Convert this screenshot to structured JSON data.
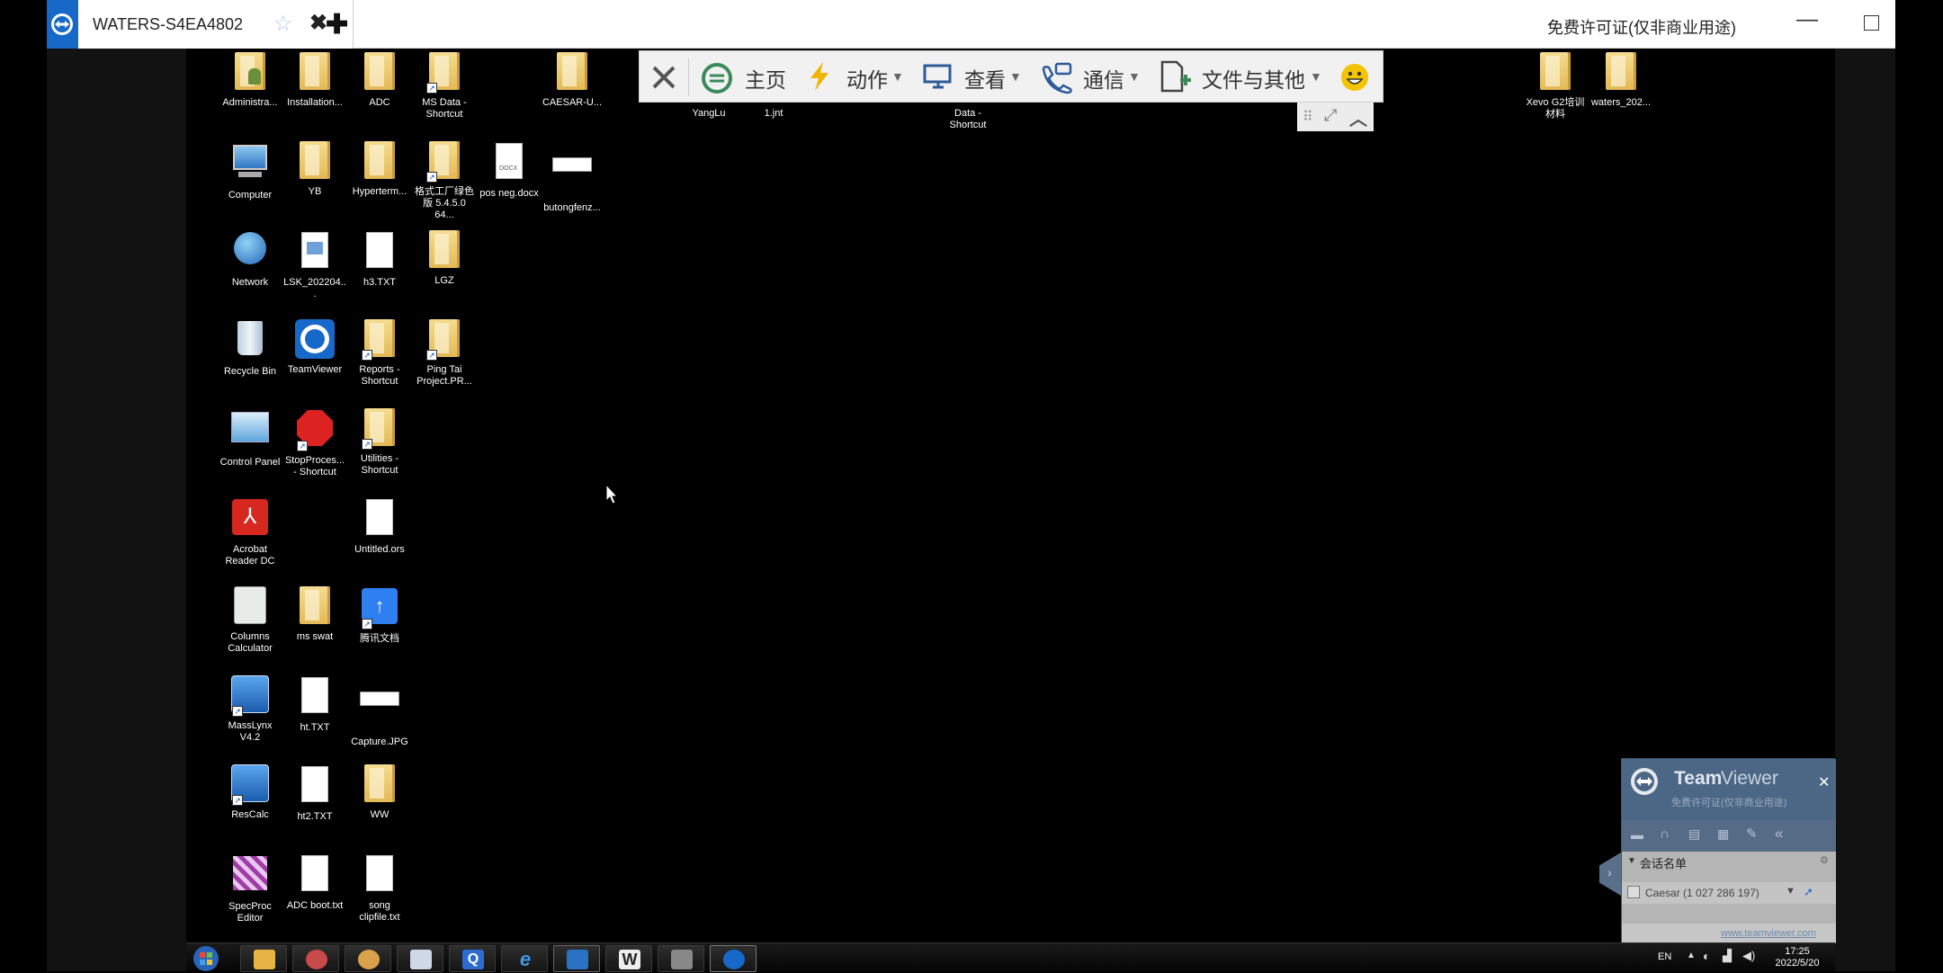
{
  "window": {
    "tab_title": "WATERS-S4EA4802",
    "license_text": "免费许可证(仅非商业用途)",
    "add_tab_glyph": "✚",
    "close_glyph": "✖",
    "star_glyph": "☆"
  },
  "toolbar": {
    "home_label": "主页",
    "actions_label": "动作",
    "view_label": "查看",
    "communicate_label": "通信",
    "files_label": "文件与其他"
  },
  "desktop": {
    "icons": [
      {
        "label": "Administra...",
        "kind": "user-folder-icon"
      },
      {
        "label": "Installation...",
        "kind": "folder-icon"
      },
      {
        "label": "ADC",
        "kind": "folder-icon"
      },
      {
        "label": "MS Data - Shortcut",
        "kind": "folder-shortcut-icon"
      },
      {
        "label": "CAESAR-U...",
        "kind": "folder-icon"
      },
      {
        "label": "YangLu",
        "kind": "folder-icon"
      },
      {
        "label": "1.jnt",
        "kind": "file-icon"
      },
      {
        "label": "Data - Shortcut",
        "kind": "folder-shortcut-icon"
      },
      {
        "label": "Xevo G2培训材料",
        "kind": "folder-icon"
      },
      {
        "label": "waters_202...",
        "kind": "folder-icon"
      },
      {
        "label": "Computer",
        "kind": "computer-icon"
      },
      {
        "label": "YB",
        "kind": "folder-icon"
      },
      {
        "label": "Hyperterm...",
        "kind": "folder-icon"
      },
      {
        "label": "格式工厂绿色版 5.4.5.0 64...",
        "kind": "folder-shortcut-icon"
      },
      {
        "label": "pos neg.docx",
        "kind": "docx-icon"
      },
      {
        "label": "butongfenz...",
        "kind": "image-icon"
      },
      {
        "label": "Network",
        "kind": "network-icon"
      },
      {
        "label": "LSK_202204...",
        "kind": "document-icon"
      },
      {
        "label": "h3.TXT",
        "kind": "text-file-icon"
      },
      {
        "label": "LGZ",
        "kind": "folder-icon"
      },
      {
        "label": "Recycle Bin",
        "kind": "recycle-bin-icon"
      },
      {
        "label": "TeamViewer",
        "kind": "teamviewer-icon"
      },
      {
        "label": "Reports - Shortcut",
        "kind": "folder-shortcut-icon"
      },
      {
        "label": "Ping Tai Project.PR...",
        "kind": "folder-shortcut-icon"
      },
      {
        "label": "Control Panel",
        "kind": "control-panel-icon"
      },
      {
        "label": "StopProces... - Shortcut",
        "kind": "stop-hand-icon"
      },
      {
        "label": "Utilities - Shortcut",
        "kind": "folder-shortcut-icon"
      },
      {
        "label": "Acrobat Reader DC",
        "kind": "acrobat-icon"
      },
      {
        "label": "Untitled.ors",
        "kind": "file-icon"
      },
      {
        "label": "Columns Calculator",
        "kind": "calculator-icon"
      },
      {
        "label": "ms swat",
        "kind": "folder-icon"
      },
      {
        "label": "腾讯文档",
        "kind": "tencent-docs-icon"
      },
      {
        "label": "MassLynx V4.2",
        "kind": "masslynx-icon"
      },
      {
        "label": "ht.TXT",
        "kind": "text-file-icon"
      },
      {
        "label": "Capture.JPG",
        "kind": "image-icon"
      },
      {
        "label": "ResCalc",
        "kind": "masslynx-icon"
      },
      {
        "label": "ht2.TXT",
        "kind": "text-file-icon"
      },
      {
        "label": "WW",
        "kind": "folder-icon"
      },
      {
        "label": "SpecProc Editor",
        "kind": "specproc-icon"
      },
      {
        "label": "ADC boot.txt",
        "kind": "text-file-icon"
      },
      {
        "label": "song clipfile.txt",
        "kind": "text-file-icon"
      }
    ]
  },
  "tv_panel": {
    "title_bold": "Team",
    "title_light": "Viewer",
    "subtitle": "免费许可证(仅非商业用途)",
    "session_list_label": "会话名单",
    "session_entry": "Caesar (1 027 286 197)",
    "website": "www.teamviewer.com",
    "close_glyph": "✕",
    "collapse_glyph": "«",
    "expand_glyph": "›"
  },
  "taskbar": {
    "language": "EN",
    "time": "17:25",
    "date": "2022/5/20",
    "apps": [
      "start-orb-icon",
      "explorer-icon",
      "snipping-icon",
      "paint-icon",
      "notepad-icon",
      "q-app-icon",
      "ie-icon",
      "masslynx-icon",
      "word-icon",
      "device-icon",
      "teamviewer-icon"
    ]
  },
  "colors": {
    "tv_blue": "#1769c9",
    "panel_blue": "#4c6785",
    "toolbar_bg": "#f1f1f1",
    "lightning": "#f0b400",
    "home_green": "#3a8a5a"
  }
}
